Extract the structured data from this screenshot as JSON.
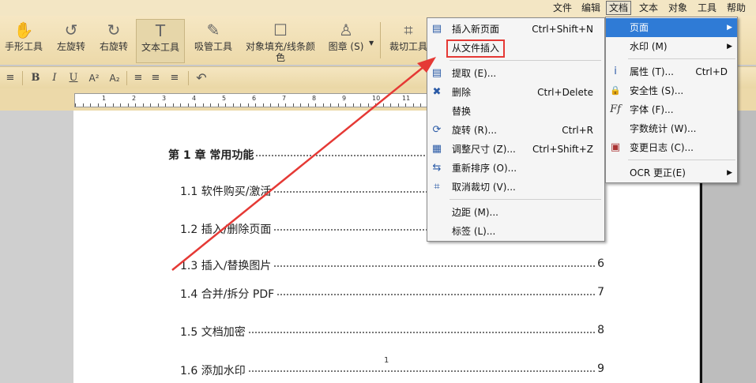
{
  "menubar": {
    "items": [
      "文件",
      "编辑",
      "文档",
      "文本",
      "对象",
      "工具",
      "帮助"
    ],
    "active": "文档"
  },
  "toolbar": {
    "tools": [
      {
        "label": "手形工具",
        "icon": "hand-icon",
        "glyph": "✋"
      },
      {
        "label": "左旋转",
        "icon": "rotate-left-icon",
        "glyph": "↺"
      },
      {
        "label": "右旋转",
        "icon": "rotate-right-icon",
        "glyph": "↻"
      },
      {
        "label": "文本工具",
        "icon": "text-tool-icon",
        "glyph": "T"
      },
      {
        "label": "吸管工具",
        "icon": "eyedropper-icon",
        "glyph": "✎"
      },
      {
        "label": "对象填充/线条颜色",
        "icon": "fill-color-icon",
        "glyph": "☐"
      },
      {
        "label": "图章 (S)",
        "icon": "stamp-icon",
        "glyph": "♙"
      },
      {
        "label": "裁切工具",
        "icon": "crop-icon",
        "glyph": "⌗"
      }
    ]
  },
  "formatbar": {
    "bold": "B",
    "italic": "I",
    "underline": "U",
    "superscript": "A²",
    "subscript": "A₂"
  },
  "ruler": {
    "ticks": [
      "1",
      "2",
      "3",
      "4",
      "5",
      "6",
      "7",
      "8",
      "9",
      "10",
      "11"
    ]
  },
  "document": {
    "toc": [
      {
        "title": "第 1 章  常用功能",
        "page": ""
      },
      {
        "title": "1.1 软件购买/激活",
        "page": ""
      },
      {
        "title": "1.2 插入/删除页面",
        "page": ""
      },
      {
        "title": "1.3 插入/替换图片",
        "page": "6"
      },
      {
        "title": "1.4 合并/拆分 PDF",
        "page": "7"
      },
      {
        "title": "1.5 文档加密",
        "page": "8"
      },
      {
        "title": "1.6 添加水印",
        "page": "9"
      }
    ],
    "page_number": "1"
  },
  "doc_menu": {
    "groups": [
      [
        {
          "label": "插入新页面",
          "shortcut": "Ctrl+Shift+N",
          "icon": "insert-page-icon",
          "glyph": "▤"
        },
        {
          "label": "从文件插入",
          "shortcut": "",
          "icon": "",
          "glyph": "",
          "highlighted": true
        }
      ],
      [
        {
          "label": "提取 (E)...",
          "shortcut": "",
          "icon": "extract-icon",
          "glyph": "▤"
        },
        {
          "label": "删除",
          "shortcut": "Ctrl+Delete",
          "icon": "delete-page-icon",
          "glyph": "✖"
        },
        {
          "label": "替换",
          "shortcut": "",
          "icon": "",
          "glyph": ""
        },
        {
          "label": "旋转 (R)...",
          "shortcut": "Ctrl+R",
          "icon": "rotate-page-icon",
          "glyph": "⟳"
        },
        {
          "label": "调整尺寸 (Z)...",
          "shortcut": "Ctrl+Shift+Z",
          "icon": "resize-icon",
          "glyph": "▦"
        },
        {
          "label": "重新排序 (O)...",
          "shortcut": "",
          "icon": "reorder-icon",
          "glyph": "⇆"
        },
        {
          "label": "取消裁切 (V)...",
          "shortcut": "",
          "icon": "uncrop-icon",
          "glyph": "⌗"
        }
      ],
      [
        {
          "label": "边距 (M)...",
          "shortcut": "",
          "icon": "",
          "glyph": ""
        },
        {
          "label": "标签 (L)...",
          "shortcut": "",
          "icon": "",
          "glyph": ""
        }
      ]
    ]
  },
  "main_menu": {
    "items": [
      {
        "label": "页面",
        "shortcut": "",
        "submenu": true,
        "icon": "",
        "glyph": "",
        "active": true
      },
      {
        "label": "水印 (M)",
        "shortcut": "",
        "submenu": true,
        "icon": "",
        "glyph": ""
      },
      {
        "sep": true
      },
      {
        "label": "属性 (T)...",
        "shortcut": "Ctrl+D",
        "submenu": false,
        "icon": "info-icon",
        "glyph": "i"
      },
      {
        "label": "安全性 (S)...",
        "shortcut": "",
        "submenu": false,
        "icon": "lock-icon",
        "glyph": "🔒"
      },
      {
        "label": "字体 (F)...",
        "shortcut": "",
        "submenu": false,
        "icon": "font-icon",
        "glyph": "Ff"
      },
      {
        "label": "字数统计 (W)...",
        "shortcut": "",
        "submenu": false,
        "icon": "",
        "glyph": ""
      },
      {
        "label": "变更日志 (C)...",
        "shortcut": "",
        "submenu": false,
        "icon": "changelog-icon",
        "glyph": "▣"
      },
      {
        "sep": true
      },
      {
        "label": "OCR 更正(E)",
        "shortcut": "",
        "submenu": true,
        "icon": "",
        "glyph": ""
      }
    ]
  },
  "colors": {
    "menu_highlight": "#2f7bd6",
    "callout_red": "#e53935",
    "arrow_red": "#e53935"
  }
}
